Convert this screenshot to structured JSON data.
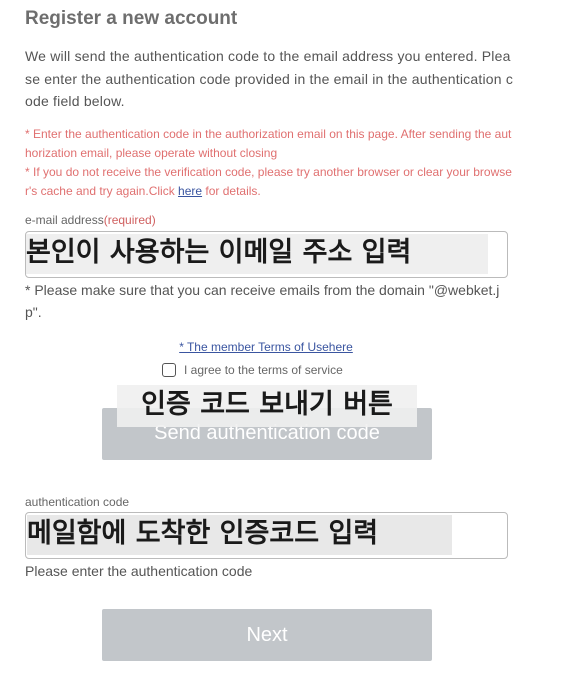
{
  "title": "Register a new account",
  "intro": "We will send the authentication code to the email address you entered. Please enter the authentication code provided in the email in the authentication code field below.",
  "notes": {
    "line1": "* Enter the authentication code in the authorization email on this page. After sending the authorization email, please operate without closing",
    "line2_before": "* If you do not receive the verification code, please try another browser or clear your browser's cache and try again.Click ",
    "line2_link": "here",
    "line2_after": " for details."
  },
  "email": {
    "label": "e-mail address",
    "required": "(required)",
    "overlay": "본인이 사용하는 이메일 주소 입력",
    "help": "* Please make sure that you can receive emails from the domain \"@webket.jp\"."
  },
  "terms": {
    "link": "* The member Terms of Usehere",
    "agree": "I agree to the terms of service"
  },
  "send": {
    "overlay": "인증 코드 보내기 버튼",
    "label": "Send authentication code"
  },
  "code": {
    "label": "authentication code",
    "overlay": "메일함에 도착한 인증코드 입력",
    "help": "Please enter the authentication code"
  },
  "next": {
    "label": "Next"
  }
}
